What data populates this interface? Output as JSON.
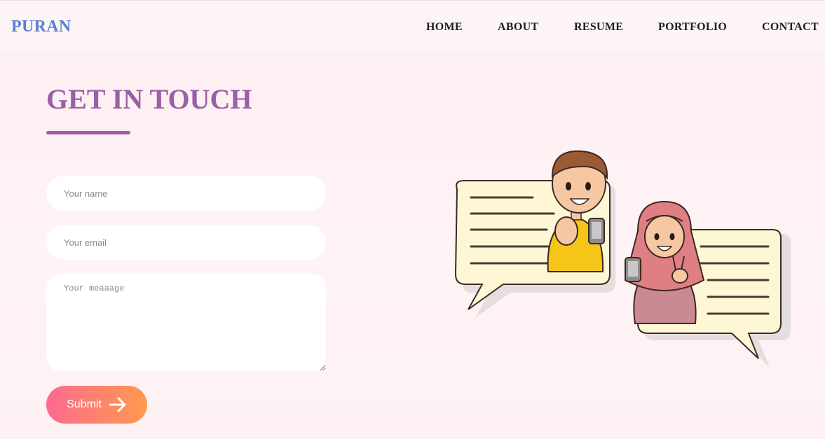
{
  "nav": {
    "brand": "PURAN",
    "links": [
      "HOME",
      "ABOUT",
      "RESUME",
      "PORTFOLIO",
      "CONTACT"
    ]
  },
  "contact": {
    "heading": "GET IN TOUCH",
    "name_placeholder": "Your name",
    "email_placeholder": "Your email",
    "message_placeholder": "Your meaaage",
    "submit_label": "Submit",
    "submit_icon": "arrow-right-icon"
  },
  "colors": {
    "brand": "#5b7fd6",
    "heading": "#9a5fa8",
    "button_start": "#fd6a8f",
    "button_end": "#ff9a4e",
    "background": "#fdeff1"
  },
  "illustration": {
    "icon": "chatting-people-illustration"
  }
}
